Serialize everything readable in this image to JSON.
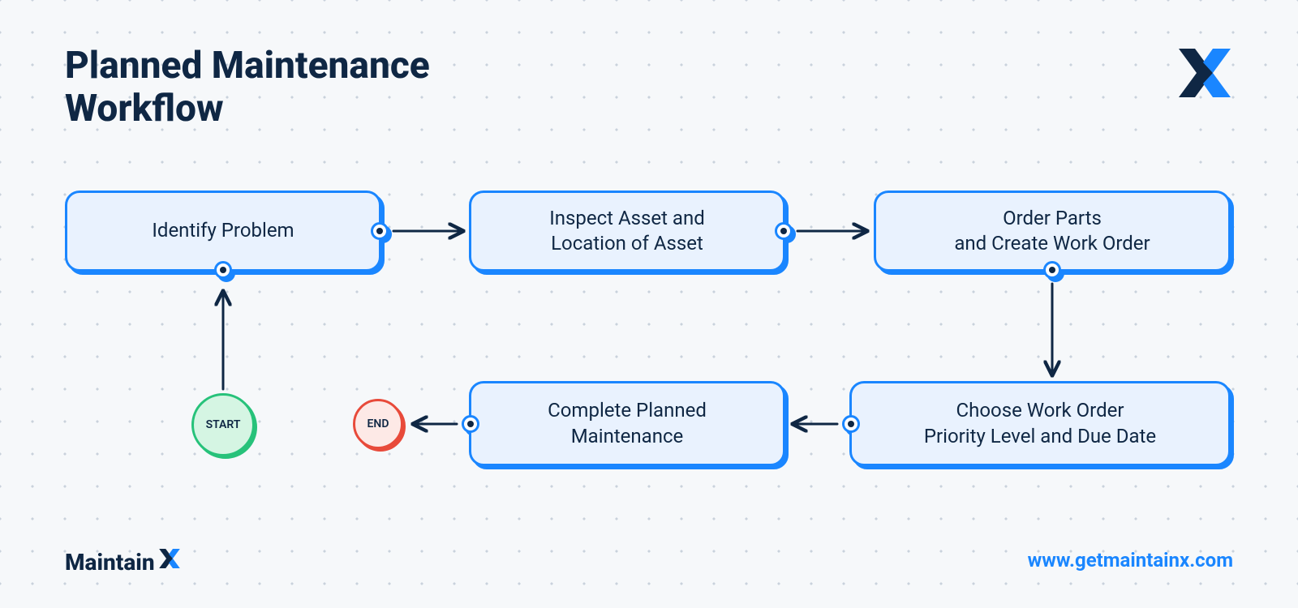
{
  "title": "Planned Maintenance\nWorkflow",
  "nodes": {
    "n1": "Identify Problem",
    "n2": "Inspect Asset and\nLocation of Asset",
    "n3": "Order Parts\nand Create Work Order",
    "n4": "Choose Work Order\nPriority Level and Due Date",
    "n5": "Complete Planned\nMaintenance"
  },
  "start": "START",
  "end": "END",
  "brand": "Maintain",
  "url": "www.getmaintainx.com",
  "colors": {
    "primary": "#1a86ff",
    "dark": "#0f2744",
    "nodeBg": "#e9f2fe",
    "start": "#27c27a",
    "end": "#e84a3a"
  }
}
